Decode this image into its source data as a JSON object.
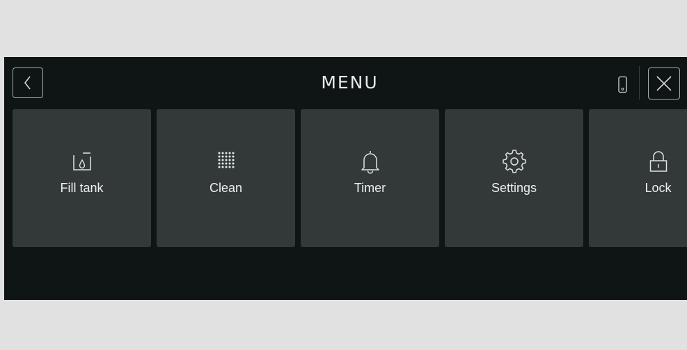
{
  "header": {
    "title": "MENU"
  },
  "icons": {
    "back": "chevron-left-icon",
    "close": "close-icon",
    "phone": "phone-icon"
  },
  "menu": {
    "items": [
      {
        "label": "Fill tank",
        "icon": "fill-tank-icon"
      },
      {
        "label": "Clean",
        "icon": "clean-dots-icon"
      },
      {
        "label": "Timer",
        "icon": "bell-icon"
      },
      {
        "label": "Settings",
        "icon": "gear-icon"
      },
      {
        "label": "Lock",
        "icon": "lock-icon"
      }
    ]
  },
  "colors": {
    "page_background": "#e1e1e1",
    "panel_background": "#0f1414",
    "tile_background": "#333939",
    "text": "#eeeeee",
    "outline": "#a7abab"
  }
}
